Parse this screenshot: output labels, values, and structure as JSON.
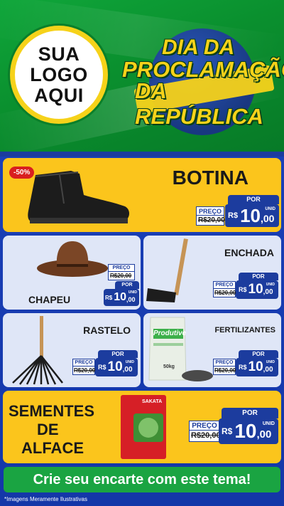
{
  "header": {
    "logo_lines": [
      "SUA",
      "LOGO",
      "AQUI"
    ],
    "title_lines": [
      "DIA DA",
      "PROCLAMAÇÃO",
      "DA REPÚBLICA"
    ]
  },
  "products": {
    "botina": {
      "name": "BOTINA",
      "badge": "-50%",
      "preco_label": "PREÇO",
      "por_label": "POR",
      "old_price": "R$20,00",
      "currency": "R$",
      "price_int": "10",
      "price_dec": ",00",
      "unit": "UNID"
    },
    "chapeu": {
      "name": "CHAPEU",
      "preco_label": "PREÇO",
      "por_label": "POR",
      "old_price": "R$20,00",
      "currency": "R$",
      "price_int": "10",
      "price_dec": ",00",
      "unit": "UNID"
    },
    "enchada": {
      "name": "ENCHADA",
      "preco_label": "PREÇO",
      "por_label": "POR",
      "old_price": "R$20,00",
      "currency": "R$",
      "price_int": "10",
      "price_dec": ",00",
      "unit": "UNID"
    },
    "rastelo": {
      "name": "RASTELO",
      "preco_label": "PREÇO",
      "por_label": "POR",
      "old_price": "R$20,00",
      "currency": "R$",
      "price_int": "10",
      "price_dec": ",00",
      "unit": "UNID"
    },
    "fertilizantes": {
      "name": "FERTILIZANTES",
      "bag_label": "Produtive",
      "bag_weight": "50kg",
      "preco_label": "PREÇO",
      "por_label": "POR",
      "old_price": "R$20,00",
      "currency": "R$",
      "price_int": "10",
      "price_dec": ",00",
      "unit": "UNID"
    },
    "sementes": {
      "name_lines": [
        "SEMENTES",
        "DE",
        "ALFACE"
      ],
      "pack_label": "SAKATA",
      "preco_label": "PREÇO",
      "por_label": "POR",
      "old_price": "R$20,00",
      "currency": "R$",
      "price_int": "10",
      "price_dec": ",00",
      "unit": "UNID"
    }
  },
  "cta": {
    "text": "Crie seu encarte com este tema!"
  },
  "footnote": "*Imagens Meramente Ilustrativas",
  "colors": {
    "green": "#0fa63a",
    "yellow": "#fbc51c",
    "blue": "#1c3c9e",
    "light_card": "#dfe6f7",
    "badge_red": "#d91f1f"
  }
}
